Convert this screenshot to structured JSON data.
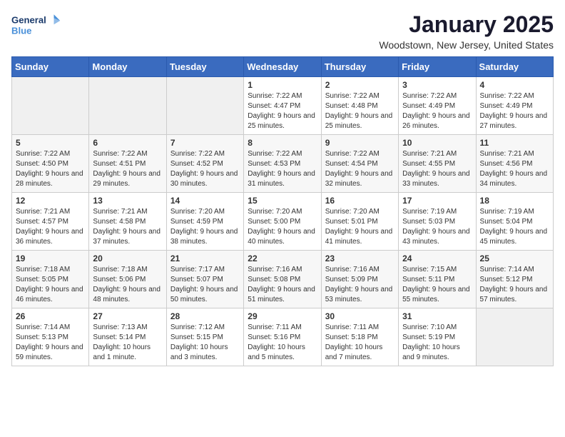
{
  "logo": {
    "line1": "General",
    "line2": "Blue"
  },
  "title": "January 2025",
  "location": "Woodstown, New Jersey, United States",
  "weekdays": [
    "Sunday",
    "Monday",
    "Tuesday",
    "Wednesday",
    "Thursday",
    "Friday",
    "Saturday"
  ],
  "weeks": [
    [
      {
        "day": "",
        "empty": true
      },
      {
        "day": "",
        "empty": true
      },
      {
        "day": "",
        "empty": true
      },
      {
        "day": "1",
        "sunrise": "7:22 AM",
        "sunset": "4:47 PM",
        "daylight": "9 hours and 25 minutes."
      },
      {
        "day": "2",
        "sunrise": "7:22 AM",
        "sunset": "4:48 PM",
        "daylight": "9 hours and 25 minutes."
      },
      {
        "day": "3",
        "sunrise": "7:22 AM",
        "sunset": "4:49 PM",
        "daylight": "9 hours and 26 minutes."
      },
      {
        "day": "4",
        "sunrise": "7:22 AM",
        "sunset": "4:49 PM",
        "daylight": "9 hours and 27 minutes."
      }
    ],
    [
      {
        "day": "5",
        "sunrise": "7:22 AM",
        "sunset": "4:50 PM",
        "daylight": "9 hours and 28 minutes."
      },
      {
        "day": "6",
        "sunrise": "7:22 AM",
        "sunset": "4:51 PM",
        "daylight": "9 hours and 29 minutes."
      },
      {
        "day": "7",
        "sunrise": "7:22 AM",
        "sunset": "4:52 PM",
        "daylight": "9 hours and 30 minutes."
      },
      {
        "day": "8",
        "sunrise": "7:22 AM",
        "sunset": "4:53 PM",
        "daylight": "9 hours and 31 minutes."
      },
      {
        "day": "9",
        "sunrise": "7:22 AM",
        "sunset": "4:54 PM",
        "daylight": "9 hours and 32 minutes."
      },
      {
        "day": "10",
        "sunrise": "7:21 AM",
        "sunset": "4:55 PM",
        "daylight": "9 hours and 33 minutes."
      },
      {
        "day": "11",
        "sunrise": "7:21 AM",
        "sunset": "4:56 PM",
        "daylight": "9 hours and 34 minutes."
      }
    ],
    [
      {
        "day": "12",
        "sunrise": "7:21 AM",
        "sunset": "4:57 PM",
        "daylight": "9 hours and 36 minutes."
      },
      {
        "day": "13",
        "sunrise": "7:21 AM",
        "sunset": "4:58 PM",
        "daylight": "9 hours and 37 minutes."
      },
      {
        "day": "14",
        "sunrise": "7:20 AM",
        "sunset": "4:59 PM",
        "daylight": "9 hours and 38 minutes."
      },
      {
        "day": "15",
        "sunrise": "7:20 AM",
        "sunset": "5:00 PM",
        "daylight": "9 hours and 40 minutes."
      },
      {
        "day": "16",
        "sunrise": "7:20 AM",
        "sunset": "5:01 PM",
        "daylight": "9 hours and 41 minutes."
      },
      {
        "day": "17",
        "sunrise": "7:19 AM",
        "sunset": "5:03 PM",
        "daylight": "9 hours and 43 minutes."
      },
      {
        "day": "18",
        "sunrise": "7:19 AM",
        "sunset": "5:04 PM",
        "daylight": "9 hours and 45 minutes."
      }
    ],
    [
      {
        "day": "19",
        "sunrise": "7:18 AM",
        "sunset": "5:05 PM",
        "daylight": "9 hours and 46 minutes."
      },
      {
        "day": "20",
        "sunrise": "7:18 AM",
        "sunset": "5:06 PM",
        "daylight": "9 hours and 48 minutes."
      },
      {
        "day": "21",
        "sunrise": "7:17 AM",
        "sunset": "5:07 PM",
        "daylight": "9 hours and 50 minutes."
      },
      {
        "day": "22",
        "sunrise": "7:16 AM",
        "sunset": "5:08 PM",
        "daylight": "9 hours and 51 minutes."
      },
      {
        "day": "23",
        "sunrise": "7:16 AM",
        "sunset": "5:09 PM",
        "daylight": "9 hours and 53 minutes."
      },
      {
        "day": "24",
        "sunrise": "7:15 AM",
        "sunset": "5:11 PM",
        "daylight": "9 hours and 55 minutes."
      },
      {
        "day": "25",
        "sunrise": "7:14 AM",
        "sunset": "5:12 PM",
        "daylight": "9 hours and 57 minutes."
      }
    ],
    [
      {
        "day": "26",
        "sunrise": "7:14 AM",
        "sunset": "5:13 PM",
        "daylight": "9 hours and 59 minutes."
      },
      {
        "day": "27",
        "sunrise": "7:13 AM",
        "sunset": "5:14 PM",
        "daylight": "10 hours and 1 minute."
      },
      {
        "day": "28",
        "sunrise": "7:12 AM",
        "sunset": "5:15 PM",
        "daylight": "10 hours and 3 minutes."
      },
      {
        "day": "29",
        "sunrise": "7:11 AM",
        "sunset": "5:16 PM",
        "daylight": "10 hours and 5 minutes."
      },
      {
        "day": "30",
        "sunrise": "7:11 AM",
        "sunset": "5:18 PM",
        "daylight": "10 hours and 7 minutes."
      },
      {
        "day": "31",
        "sunrise": "7:10 AM",
        "sunset": "5:19 PM",
        "daylight": "10 hours and 9 minutes."
      },
      {
        "day": "",
        "empty": true
      }
    ]
  ]
}
